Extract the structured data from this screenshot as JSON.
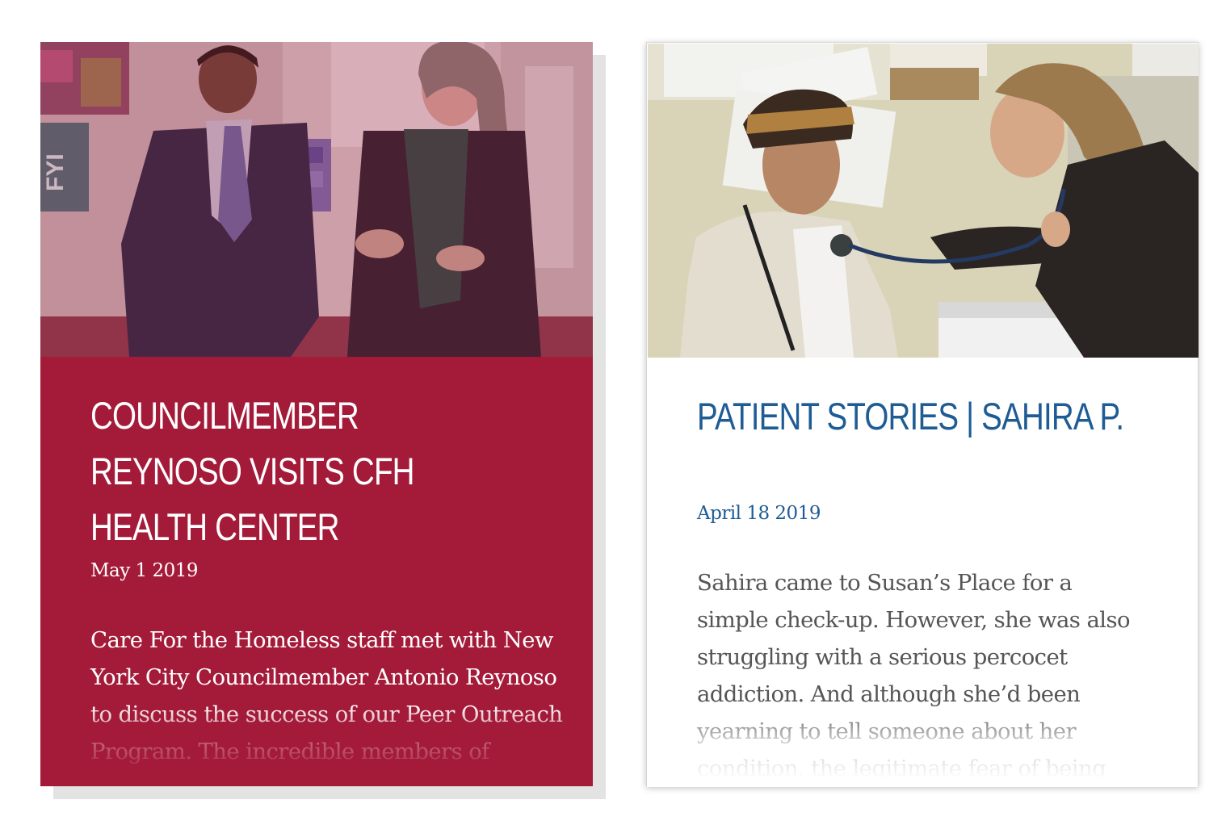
{
  "cards": [
    {
      "title": "COUNCILMEMBER REYNOSO VISITS CFH HEALTH CENTER",
      "date": "May 1 2019",
      "excerpt": "Care For the Homeless staff met with New York City Councilmember Antonio Reynoso to discuss the success of our Peer Outreach Program. The incredible members of",
      "sign_text": "FYI",
      "accent_color": "#a41b3a"
    },
    {
      "title": "PATIENT STORIES | SAHIRA P.",
      "date": "April 18 2019",
      "excerpt": "Sahira came to Susan’s Place for a simple check-up. However, she was also struggling with a serious percocet addiction. And although she’d been yearning to tell someone about her condition, the legitimate fear of being judged and stigmatized",
      "accent_color": "#1f5c94"
    }
  ]
}
